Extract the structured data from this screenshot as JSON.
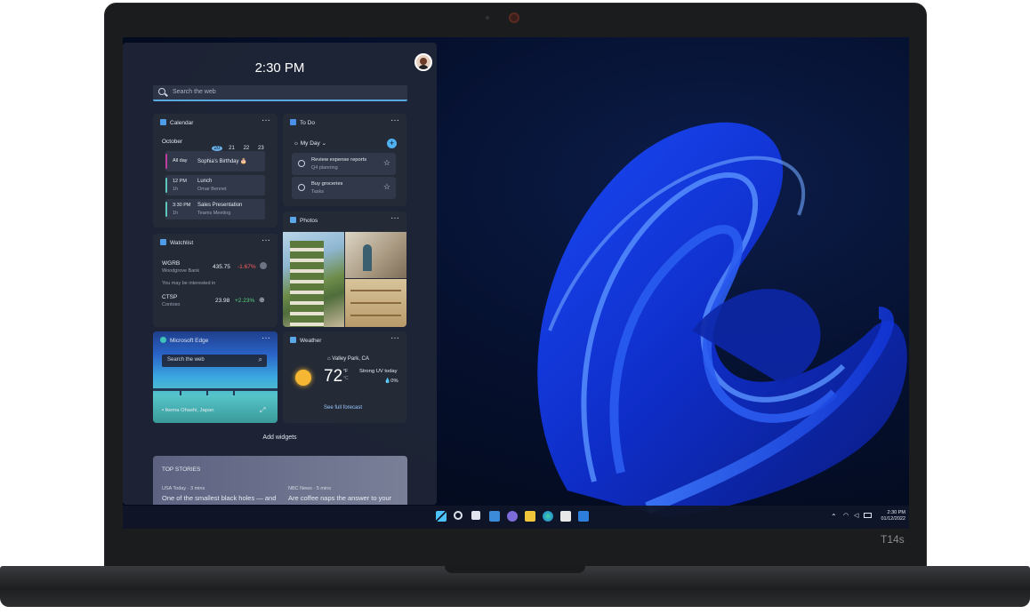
{
  "device": {
    "model_label": "T14s"
  },
  "widgets_panel": {
    "time": "2:30 PM",
    "search_placeholder": "Search the web",
    "add_widgets_label": "Add widgets",
    "calendar": {
      "title": "Calendar",
      "month": "October",
      "days": [
        "20",
        "21",
        "22",
        "23"
      ],
      "events": [
        {
          "time": "All day",
          "duration": "",
          "title": "Sophia's Birthday 🎂",
          "subtitle": "",
          "color": "#c03c9e"
        },
        {
          "time": "12 PM",
          "duration": "1h",
          "title": "Lunch",
          "subtitle": "Omar Bennet",
          "color": "#5bc7b9"
        },
        {
          "time": "3:30 PM",
          "duration": "1h",
          "title": "Sales Presentation",
          "subtitle": "Teams Meeting",
          "color": "#5bc7b9"
        }
      ]
    },
    "todo": {
      "title": "To Do",
      "list_name": "My Day",
      "items": [
        {
          "title": "Review expense reports",
          "subtitle": "Q4 planning"
        },
        {
          "title": "Buy groceries",
          "subtitle": "Tasks"
        }
      ]
    },
    "watchlist": {
      "title": "Watchlist",
      "stocks": [
        {
          "symbol": "WGRB",
          "name": "Woodgrove Bank",
          "price": "435.75",
          "change": "-1.67%",
          "change_color": "#ff5f5f"
        },
        {
          "symbol": "CTSP",
          "name": "Contoso",
          "price": "23.98",
          "change": "+2.23%",
          "change_color": "#59d27a"
        }
      ],
      "suggest_label": "You may be interested in"
    },
    "photos": {
      "title": "Photos"
    },
    "edge": {
      "title": "Microsoft Edge",
      "search_placeholder": "Search the web",
      "location": "Ikema Ohashi, Japan"
    },
    "weather": {
      "title": "Weather",
      "location": "Valley Park, CA",
      "temperature": "72",
      "unit_f": "°F",
      "unit_c": "°C",
      "condition": "Strong UV today",
      "precip": "0%",
      "forecast_link": "See full forecast"
    },
    "top_stories": {
      "title": "TOP STORIES",
      "stories": [
        {
          "source": "USA Today · 3 mins",
          "headline": "One of the smallest black holes — and"
        },
        {
          "source": "NBC News · 5 mins",
          "headline": "Are coffee naps the answer to your"
        }
      ]
    }
  },
  "taskbar": {
    "icons": [
      "windows-icon",
      "search-icon",
      "task-view-icon",
      "widgets-icon",
      "chat-icon",
      "file-explorer-icon",
      "edge-icon",
      "store-icon",
      "mail-icon"
    ],
    "clock_time": "2:30 PM",
    "clock_date": "01/12/2022"
  }
}
